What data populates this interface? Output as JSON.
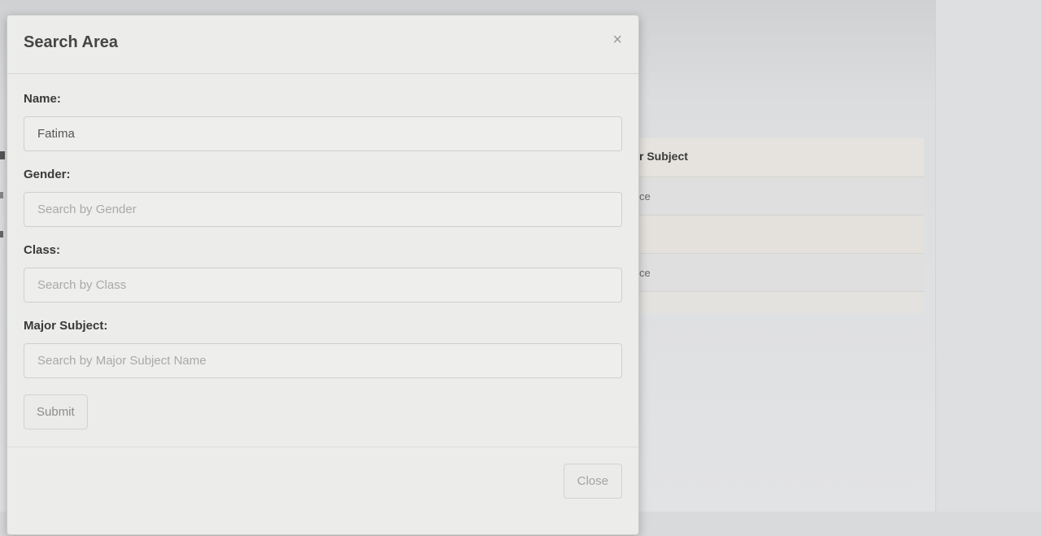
{
  "modal": {
    "title": "Search Area",
    "close_icon_glyph": "×",
    "fields": [
      {
        "label": "Name:",
        "value": "Fatima",
        "placeholder": ""
      },
      {
        "label": "Gender:",
        "value": "",
        "placeholder": "Search by Gender"
      },
      {
        "label": "Class:",
        "value": "",
        "placeholder": "Search by Class"
      },
      {
        "label": "Major Subject:",
        "value": "",
        "placeholder": "Search by Major Subject Name"
      }
    ],
    "submit_label": "Submit",
    "close_label": "Close"
  },
  "background_table": {
    "header_fragment": "r Subject",
    "cell_fragments": [
      "ce",
      "ce"
    ]
  },
  "icons": {
    "close": "close-icon"
  }
}
